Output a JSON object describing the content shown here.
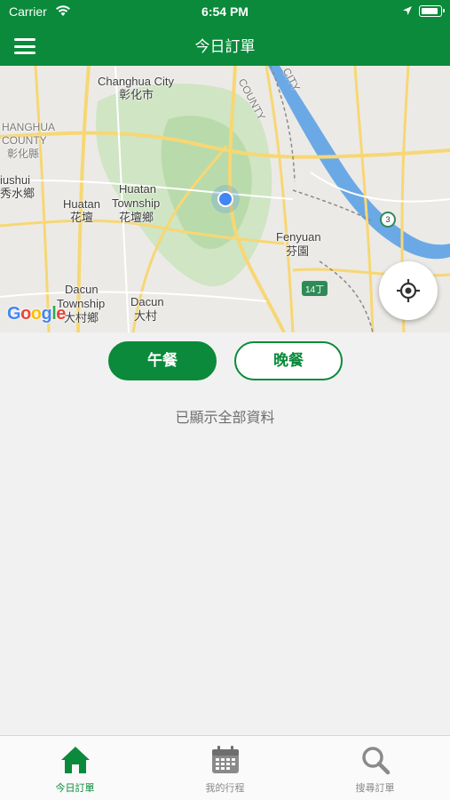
{
  "status_bar": {
    "carrier": "Carrier",
    "time": "6:54 PM",
    "icons": [
      "wifi-icon",
      "location-arrow-icon",
      "battery-icon"
    ]
  },
  "nav": {
    "title": "今日訂單",
    "menu_icon": "hamburger-menu-icon"
  },
  "map": {
    "labels": {
      "changhua_city_en": "Changhua City",
      "changhua_city_zh": "彰化市",
      "changhua_county_en_1": "HANGHUA",
      "changhua_county_en_2": "COUNTY",
      "changhua_county_zh": "彰化縣",
      "xiushui_en": "iushui",
      "xiushui_zh": "秀水鄉",
      "huatan_en": "Huatan",
      "huatan_zh": "花壇",
      "huatan_township_en_1": "Huatan",
      "huatan_township_en_2": "Township",
      "huatan_township_zh": "花壇鄉",
      "fenyuan_en": "Fenyuan",
      "fenyuan_zh": "芬園",
      "dacun_township_en_1": "Dacun",
      "dacun_township_en_2": "Township",
      "dacun_township_zh": "大村鄉",
      "dacun_en": "Dacun",
      "dacun_zh": "大村",
      "county_top": "COUNTY",
      "county_top2": "CITY"
    },
    "road_badge": "14丁",
    "highway_badge": "3",
    "attribution": "Google",
    "locate_icon": "crosshair-locate-icon"
  },
  "meal_toggle": {
    "lunch_label": "午餐",
    "dinner_label": "晚餐",
    "selected": "lunch"
  },
  "list": {
    "empty_message": "已顯示全部資料"
  },
  "tab_bar": {
    "items": [
      {
        "label": "今日訂單",
        "icon": "home-icon",
        "active": true
      },
      {
        "label": "我的行程",
        "icon": "calendar-icon",
        "active": false
      },
      {
        "label": "搜尋訂單",
        "icon": "search-icon",
        "active": false
      }
    ]
  },
  "colors": {
    "brand_green": "#0a8a3a",
    "location_blue": "#4285f4",
    "background": "#f1f1f1"
  }
}
